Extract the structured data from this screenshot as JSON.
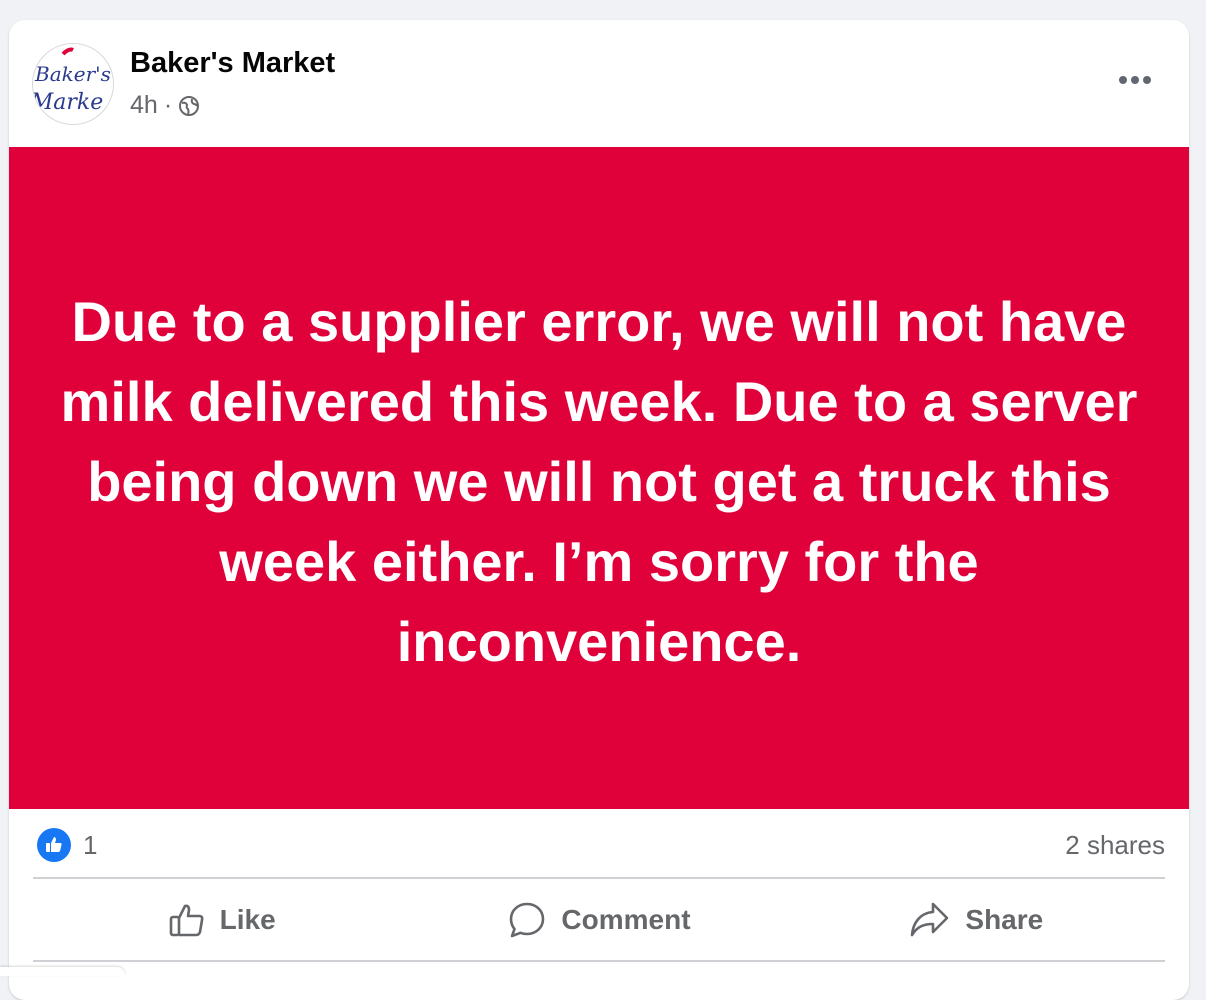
{
  "post": {
    "page_name": "Baker's Market",
    "time": "4h",
    "separator": "·",
    "privacy_icon": "globe-icon",
    "avatar_text": {
      "line1": "Baker's",
      "line2": "Marke"
    },
    "banner_color": "#e0003a",
    "message": "Due to a supplier error, we will not have milk delivered this week. Due to a server being down we will not get a truck this week either. I’m sorry for the inconvenience."
  },
  "stats": {
    "reaction_icon": "like-icon",
    "like_count": "1",
    "shares": "2 shares"
  },
  "actions": {
    "like_label": "Like",
    "comment_label": "Comment",
    "share_label": "Share"
  },
  "colors": {
    "accent": "#1877f2",
    "secondary_text": "#65676b",
    "primary_text": "#050505"
  }
}
